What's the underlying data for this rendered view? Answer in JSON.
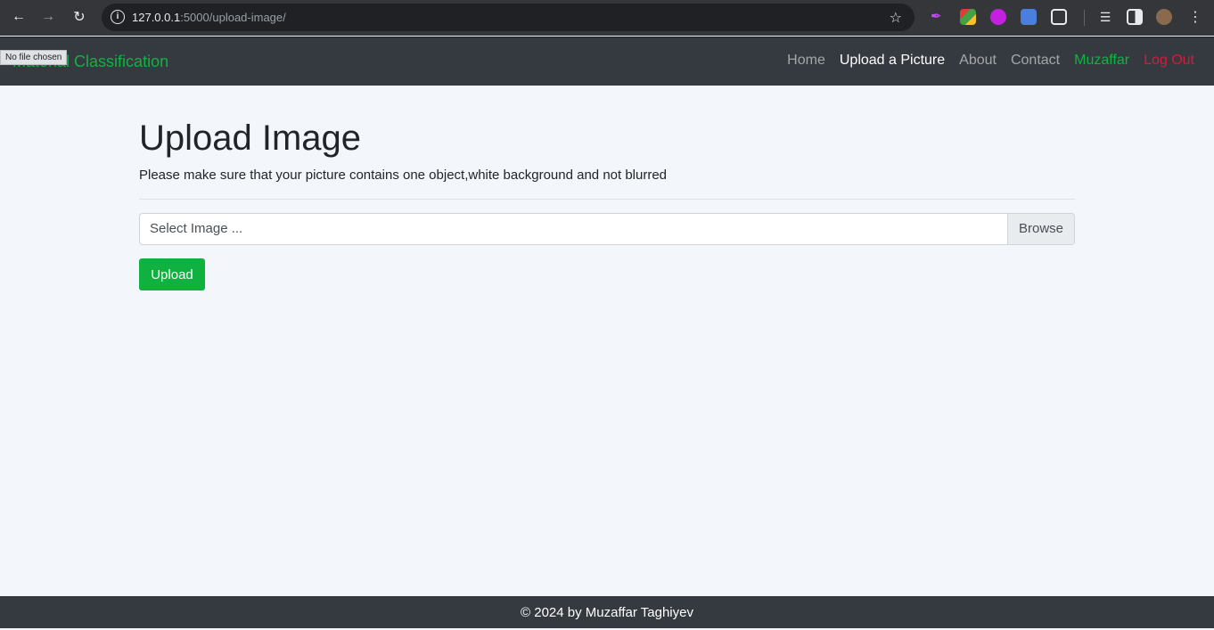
{
  "browser": {
    "url_host": "127.0.0.1",
    "url_path": ":5000/upload-image/"
  },
  "navbar": {
    "brand_hidden": "Material",
    "brand_visible": "Classification",
    "tooltip": "No file chosen",
    "links": {
      "home": "Home",
      "upload": "Upload a Picture",
      "about": "About",
      "contact": "Contact",
      "user": "Muzaffar",
      "logout": "Log Out"
    }
  },
  "main": {
    "title": "Upload Image",
    "subtitle": "Please make sure that your picture contains one object,white background and not blurred",
    "file_placeholder": "Select Image ...",
    "browse_label": "Browse",
    "upload_label": "Upload"
  },
  "footer": {
    "text": "© 2024 by Muzaffar Taghiyev"
  },
  "colors": {
    "accent_green": "#0eb43f",
    "logout_red": "#e0163a",
    "navbar_bg": "#343a40",
    "page_bg": "#f3f7fb"
  }
}
